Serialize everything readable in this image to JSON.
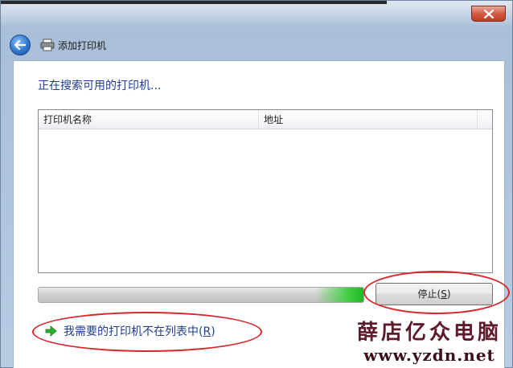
{
  "window": {
    "title": "添加打印机"
  },
  "content": {
    "heading": "正在搜索可用的打印机...",
    "columns": [
      "打印机名称",
      "地址"
    ],
    "progress": {
      "percent": 100
    },
    "stop_button": {
      "label_pre": "停止(",
      "label_key": "S",
      "label_post": ")"
    },
    "link": {
      "label_pre": "我需要的打印机不在列表中(",
      "label_key": "R",
      "label_post": ")"
    }
  },
  "watermark": {
    "chinese": "薛店亿众电脑",
    "url": "www.yzdn.net"
  },
  "colors": {
    "heading": "#1f3d9a",
    "link": "#1c3f8f",
    "progress_glow": "#3fcf3f",
    "annotation": "#d8262a"
  },
  "icons": [
    "close-icon",
    "back-arrow-icon",
    "printer-icon",
    "green-arrow-icon"
  ]
}
